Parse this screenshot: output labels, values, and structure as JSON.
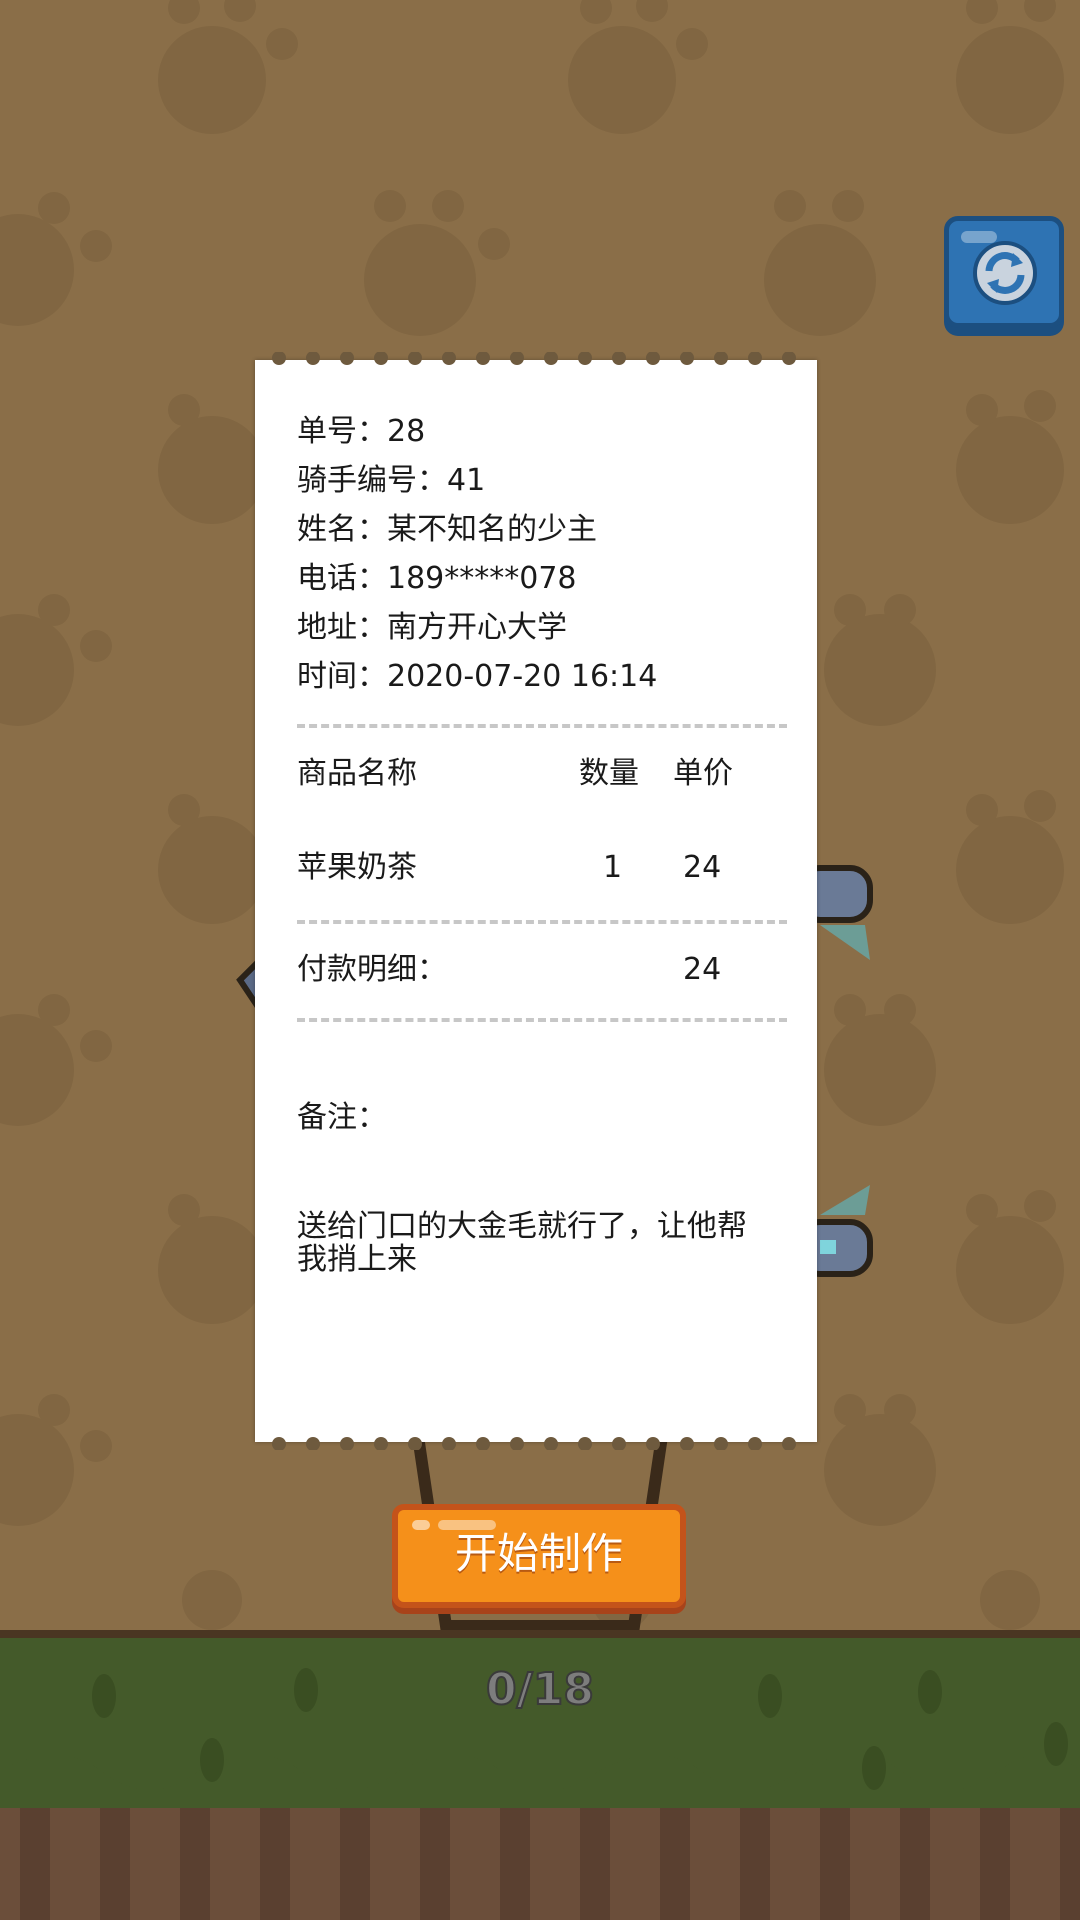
{
  "order": {
    "number_label": "单号：28",
    "rider_label": "骑手编号：41",
    "name_label": "姓名：某不知名的少主",
    "phone_label": "电话：189*****078",
    "address_label": "地址：南方开心大学",
    "time_label": "时间：2020-07-20 16:14"
  },
  "items_table": {
    "headers": {
      "name": "商品名称",
      "qty": "数量",
      "price": "单价"
    },
    "rows": [
      {
        "name": "苹果奶茶",
        "qty": "1",
        "price": "24"
      }
    ]
  },
  "payment": {
    "label": "付款明细：",
    "total": "24"
  },
  "note": {
    "label": "备注：",
    "text": "送给门口的大金毛就行了，让他帮我捎上来"
  },
  "start_button": {
    "label": "开始制作"
  },
  "progress": {
    "text": "0/18"
  },
  "icons": {
    "refresh": "refresh-icon"
  },
  "colors": {
    "background": "#8a6e48",
    "refresh_button": "#2e73b3",
    "start_button": "#f5901a",
    "grass": "#445a2a"
  }
}
